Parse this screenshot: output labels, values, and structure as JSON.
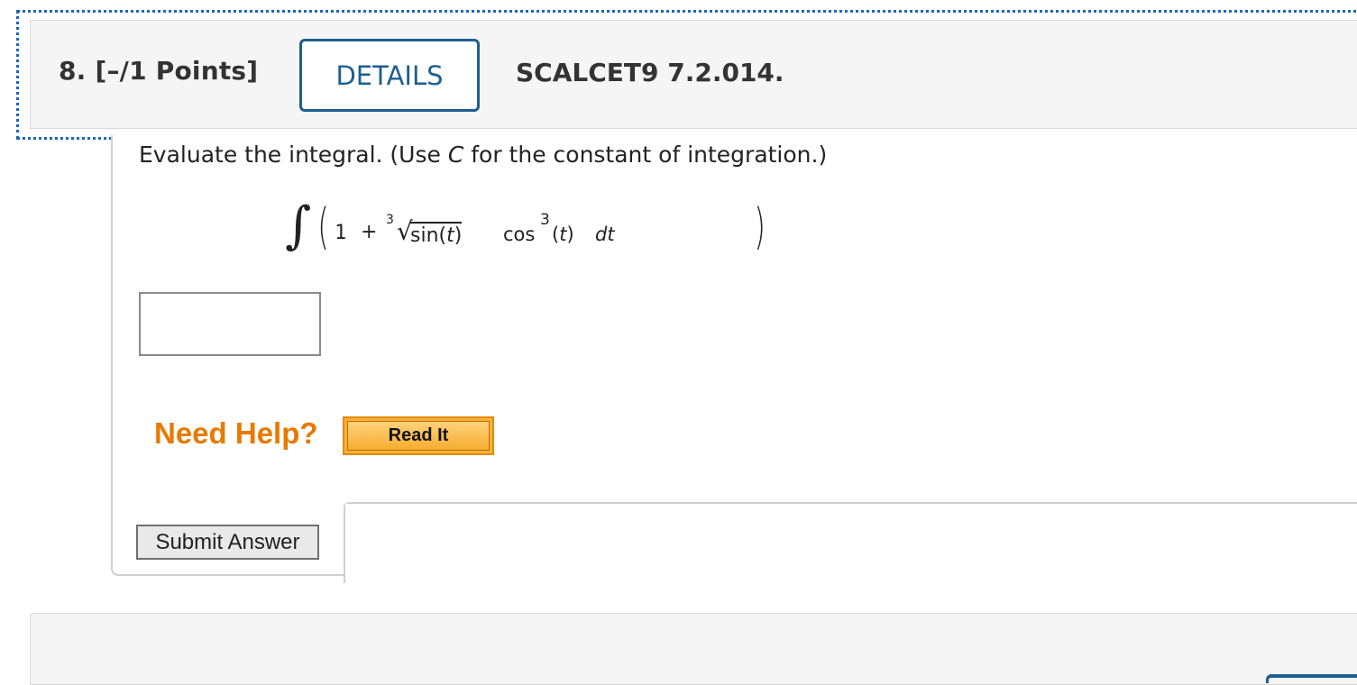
{
  "question": {
    "number_label": "8.",
    "points_label": "[–/1 Points]",
    "details_label": "DETAILS",
    "id_label": "SCALCET9 7.2.014."
  },
  "prompt": {
    "before_c": "Evaluate the integral. (Use ",
    "c_var": "C",
    "after_c": " for the constant of integration.)"
  },
  "expression": {
    "integral_sign": "∫",
    "left_paren": "(",
    "one": "1",
    "plus": "+",
    "root_index": "3",
    "radical": "√",
    "radicand_fn": "sin(",
    "radicand_var": "t",
    "radicand_close": ")",
    "right_paren": ")",
    "cos": "cos",
    "cos_exp": "3",
    "arg_open": "(",
    "arg_var": "t",
    "arg_close": ")",
    "differential": "dt"
  },
  "answer": {
    "value": ""
  },
  "help": {
    "need_help_label": "Need Help?",
    "read_it_label": "Read It"
  },
  "actions": {
    "submit_label": "Submit Answer"
  }
}
